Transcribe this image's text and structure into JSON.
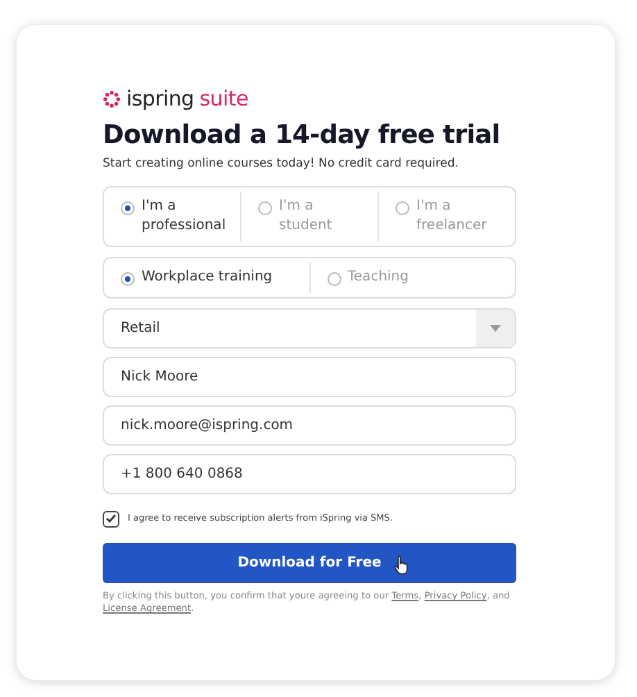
{
  "logo": {
    "brand": "ispring",
    "product": "suite"
  },
  "title": "Download a 14-day free trial",
  "subtitle": "Start creating online courses today! No credit card required.",
  "role_options": [
    {
      "label": "I'm a professional",
      "selected": true
    },
    {
      "label": "I'm a student",
      "selected": false
    },
    {
      "label": "I'm a freelancer",
      "selected": false
    }
  ],
  "purpose_options": [
    {
      "label": "Workplace training",
      "selected": true
    },
    {
      "label": "Teaching",
      "selected": false
    }
  ],
  "industry_select": {
    "value": "Retail"
  },
  "fields": [
    {
      "value": "Nick Moore"
    },
    {
      "value": "nick.moore@ispring.com"
    },
    {
      "value": "+1 800 640 0868"
    }
  ],
  "sms_consent": {
    "label": "I agree to receive subscription alerts from iSpring via SMS.",
    "checked": true
  },
  "submit_button": "Download for Free",
  "legal": [
    {
      "kind": "text",
      "text": "By clicking this button, you confirm that youre agreeing to our "
    },
    {
      "kind": "link",
      "text": "Terms"
    },
    {
      "kind": "text",
      "text": ", "
    },
    {
      "kind": "link",
      "text": "Privacy Policy"
    },
    {
      "kind": "text",
      "text": ", and "
    },
    {
      "kind": "link",
      "text": "License Agreement"
    },
    {
      "kind": "text",
      "text": "."
    }
  ]
}
